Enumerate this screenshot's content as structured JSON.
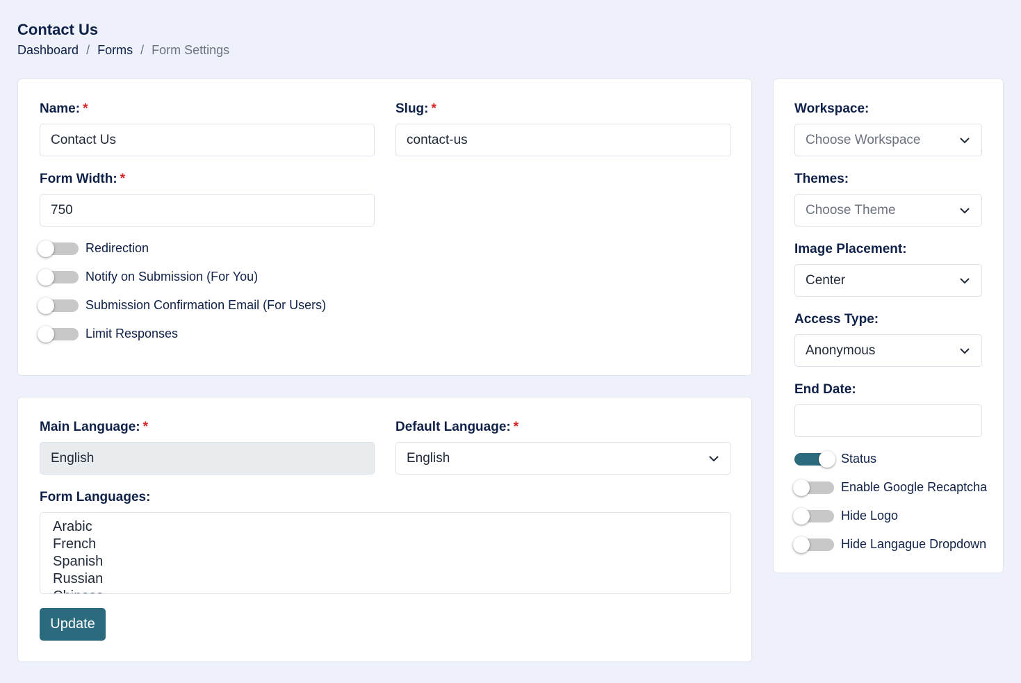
{
  "header": {
    "title": "Contact Us",
    "breadcrumb": [
      "Dashboard",
      "Forms",
      "Form Settings"
    ],
    "separator": "/"
  },
  "general": {
    "name": {
      "label": "Name:",
      "value": "Contact Us"
    },
    "slug": {
      "label": "Slug:",
      "value": "contact-us"
    },
    "form_width": {
      "label": "Form Width:",
      "value": "750"
    },
    "required_mark": "*",
    "toggles": [
      {
        "label": "Redirection",
        "on": false
      },
      {
        "label": "Notify on Submission (For You)",
        "on": false
      },
      {
        "label": "Submission Confirmation Email (For Users)",
        "on": false
      },
      {
        "label": "Limit Responses",
        "on": false
      }
    ]
  },
  "languages": {
    "main_language": {
      "label": "Main Language:",
      "value": "English"
    },
    "default_language": {
      "label": "Default Language:",
      "value": "English"
    },
    "form_languages": {
      "label": "Form Languages:",
      "options": [
        "Arabic",
        "French",
        "Spanish",
        "Russian",
        "Chinese"
      ]
    },
    "update_label": "Update"
  },
  "sidebar": {
    "workspace": {
      "label": "Workspace:",
      "placeholder": "Choose Workspace"
    },
    "themes": {
      "label": "Themes:",
      "placeholder": "Choose Theme"
    },
    "image_placement": {
      "label": "Image Placement:",
      "value": "Center"
    },
    "access_type": {
      "label": "Access Type:",
      "value": "Anonymous"
    },
    "end_date": {
      "label": "End Date:",
      "value": ""
    },
    "toggles": [
      {
        "label": "Status",
        "on": true
      },
      {
        "label": "Enable Google Recaptcha",
        "on": false
      },
      {
        "label": "Hide Logo",
        "on": false
      },
      {
        "label": "Hide Langague Dropdown",
        "on": false
      }
    ]
  },
  "colors": {
    "accent": "#2c6a7d",
    "page_bg": "#eef1f9",
    "required": "#dc2626",
    "text": "#0f2148"
  },
  "icons": {
    "select_arrow": "chevron-down-icon"
  }
}
